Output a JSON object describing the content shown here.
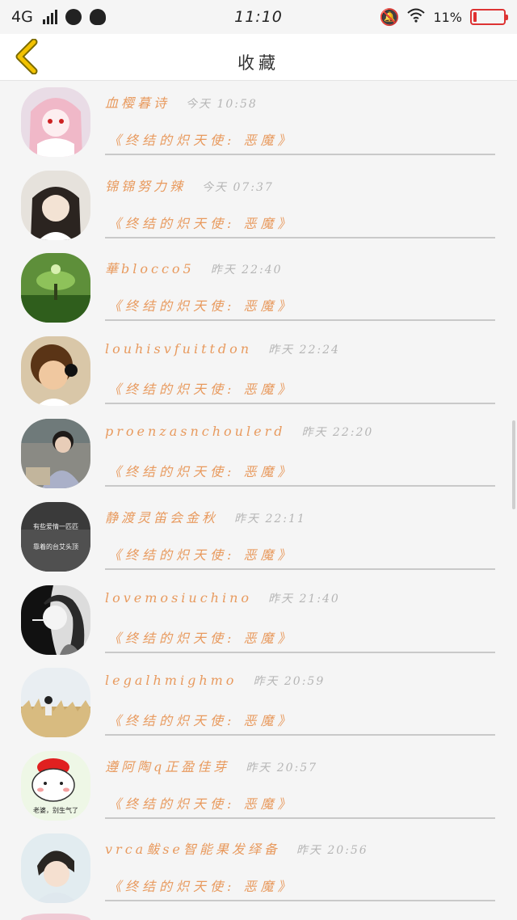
{
  "status_bar": {
    "network": "4G",
    "time": "11:10",
    "battery_text": "11%",
    "battery_level": 0.11,
    "icons": [
      "signal-icon",
      "app-icon",
      "qq-icon",
      "mute-bell-icon",
      "wifi-icon",
      "battery-icon"
    ]
  },
  "header": {
    "title": "收藏",
    "back_icon": "chevron-left-icon"
  },
  "colors": {
    "accent": "#e89a5e",
    "back_arrow": "#f2c200",
    "time_text": "#b5b5b5",
    "divider": "#c9c9c9",
    "battery": "#e03030"
  },
  "items": [
    {
      "name": "血樱暮诗",
      "time": "今天 10:58",
      "book": "《终结的炽天使: 恶魔》",
      "avatar": "anime-girl-avatar"
    },
    {
      "name": "锦锦努力辣",
      "time": "今天 07:37",
      "book": "《终结的炽天使: 恶魔》",
      "avatar": "anime-girl-avatar"
    },
    {
      "name": "華blocco5",
      "time": "昨天 22:40",
      "book": "《终结的炽天使: 恶魔》",
      "avatar": "tree-landscape-avatar"
    },
    {
      "name": "louhisvfuittdon",
      "time": "昨天 22:24",
      "book": "《终结的炽天使: 恶魔》",
      "avatar": "child-avatar"
    },
    {
      "name": "proenzasnchoulerd",
      "time": "昨天 22:20",
      "book": "《终结的炽天使: 恶魔》",
      "avatar": "person-avatar"
    },
    {
      "name": "静渡灵笛会金秋",
      "time": "昨天 22:11",
      "book": "《终结的炽天使: 恶魔》",
      "avatar": "text-image-avatar",
      "avatar_text": [
        "有些爱情一匹匹",
        "靠着的台艾头顶"
      ]
    },
    {
      "name": "lovemosiuchino",
      "time": "昨天 21:40",
      "book": "《终结的炽天使: 恶魔》",
      "avatar": "bw-portrait-avatar"
    },
    {
      "name": "legalhmighmo",
      "time": "昨天 20:59",
      "book": "《终结的炽天使: 恶魔》",
      "avatar": "field-avatar"
    },
    {
      "name": "遵阿陶q正盈佳芽",
      "time": "昨天 20:57",
      "book": "《终结的炽天使: 恶魔》",
      "avatar": "cartoon-avatar",
      "avatar_text": [
        "老婆，别生气了"
      ]
    },
    {
      "name": "vrca鲅se智能果发绎备",
      "time": "昨天 20:56",
      "book": "《终结的炽天使: 恶魔》",
      "avatar": "boy-portrait-avatar"
    }
  ]
}
